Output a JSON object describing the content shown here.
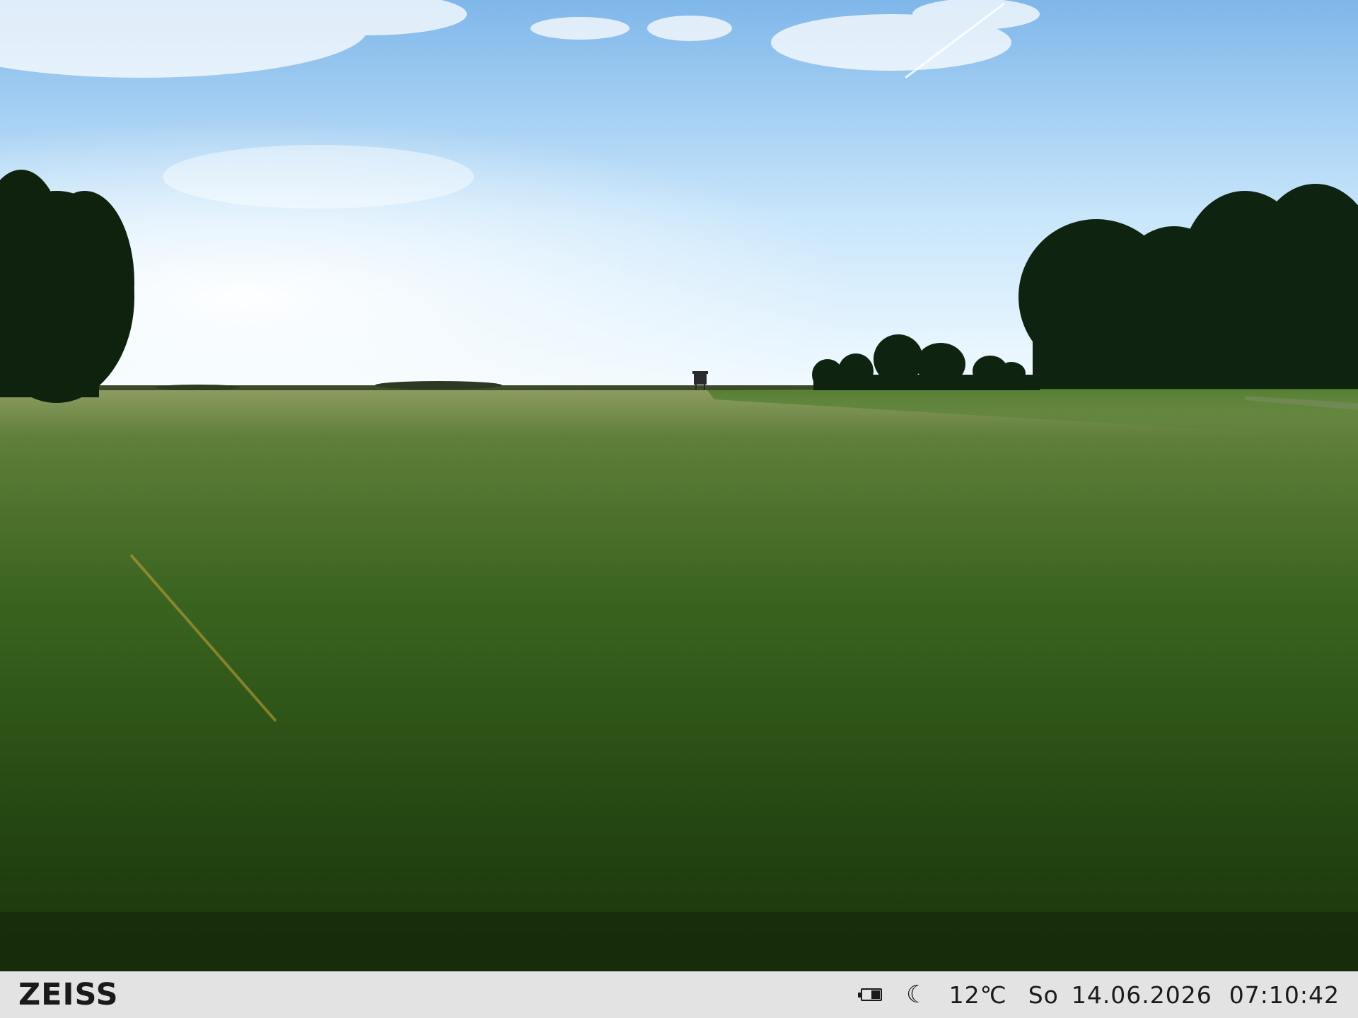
{
  "scene": {
    "description_colors": {
      "sky_top": "#8ec2ef",
      "sky_horizon": "#f4fbff",
      "field_far": "#8a9a5a",
      "field_mid": "#3f6b22",
      "field_near": "#1f3c10",
      "treeline": "#0f2410"
    }
  },
  "info_bar": {
    "brand": "ZEISS",
    "battery_level": 0.5,
    "moon_icon": "moon-phase-icon",
    "temperature": "12℃",
    "weekday": "So",
    "date": "14.06.2026",
    "time": "07:10:42"
  }
}
